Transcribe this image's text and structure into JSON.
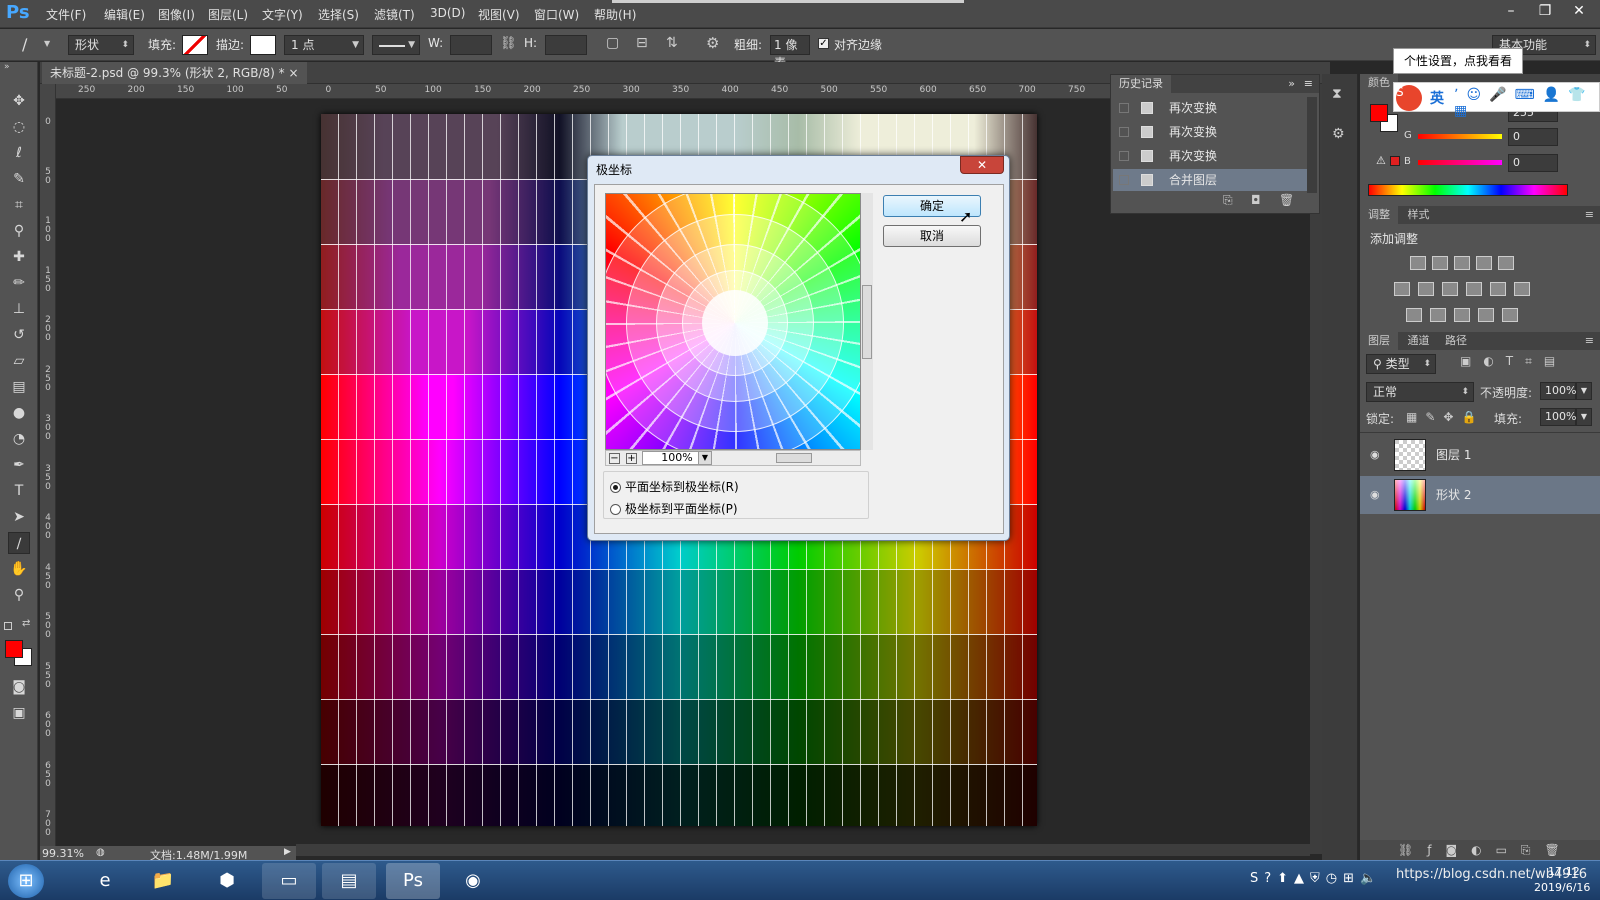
{
  "app": {
    "logo": "Ps"
  },
  "menu": [
    "文件(F)",
    "编辑(E)",
    "图像(I)",
    "图层(L)",
    "文字(Y)",
    "选择(S)",
    "滤镜(T)",
    "3D(D)",
    "视图(V)",
    "窗口(W)",
    "帮助(H)"
  ],
  "window_controls": {
    "minimize": "–",
    "restore": "❐",
    "close": "✕"
  },
  "options": {
    "mode": "形状",
    "fill_label": "填充:",
    "stroke_label": "描边:",
    "stroke_size": "1 点",
    "w_label": "W:",
    "h_label": "H:",
    "weight_label": "粗细:",
    "weight_value": "1 像素",
    "align_label": "对齐边缘",
    "workspace": "基本功能"
  },
  "doc_tab": {
    "title": "未标题-2.psd @ 99.3% (形状 2, RGB/8) *",
    "close": "×"
  },
  "ruler": {
    "h_ticks": [
      "250",
      "200",
      "150",
      "100",
      "50",
      "0",
      "50",
      "100",
      "150",
      "200",
      "250",
      "300",
      "350",
      "400",
      "450",
      "500",
      "550",
      "600",
      "650",
      "700",
      "750"
    ],
    "v_ticks": [
      "0",
      "5\n0",
      "1\n0\n0",
      "1\n5\n0",
      "2\n0\n0",
      "2\n5\n0",
      "3\n0\n0",
      "3\n5\n0",
      "4\n0\n0",
      "4\n5\n0",
      "5\n0\n0",
      "5\n5\n0",
      "6\n0\n0",
      "6\n5\n0",
      "7\n0\n0"
    ]
  },
  "status": {
    "zoom": "99.31%",
    "doc": "文档:1.48M/1.99M"
  },
  "history": {
    "tab": "历史记录",
    "items": [
      {
        "label": "再次变换",
        "selected": false
      },
      {
        "label": "再次变换",
        "selected": false
      },
      {
        "label": "再次变换",
        "selected": false
      },
      {
        "label": "合并图层",
        "selected": true
      }
    ]
  },
  "color_panel": {
    "tab": "颜色",
    "r_label": "R",
    "g_label": "G",
    "b_label": "B",
    "r_value": "255",
    "g_value": "0",
    "b_value": "0",
    "fg": "#ff0000",
    "bg": "#ffffff"
  },
  "adjust_panel": {
    "tab1": "调整",
    "tab2": "样式",
    "title": "添加调整"
  },
  "layers_panel": {
    "tab1": "图层",
    "tab2": "通道",
    "tab3": "路径",
    "filter": "类型",
    "blend": "正常",
    "opacity_label": "不透明度:",
    "opacity_value": "100%",
    "lock_label": "锁定:",
    "fill_label": "填充:",
    "fill_value": "100%",
    "layers": [
      {
        "name": "图层 1",
        "selected": false
      },
      {
        "name": "形状 2",
        "selected": true
      }
    ]
  },
  "tooltip": "个性设置，点我看看",
  "ime": {
    "mode": "英"
  },
  "dialog": {
    "title": "极坐标",
    "close": "✕",
    "ok": "确定",
    "cancel": "取消",
    "zoom": "100%",
    "options": [
      {
        "label": "平面坐标到极坐标(R)",
        "checked": true
      },
      {
        "label": "极坐标到平面坐标(P)",
        "checked": false
      }
    ]
  },
  "taskbar": {
    "time": "17:12",
    "date": "2019/6/16",
    "watermark": "https://blog.csdn.net/wb4916"
  }
}
